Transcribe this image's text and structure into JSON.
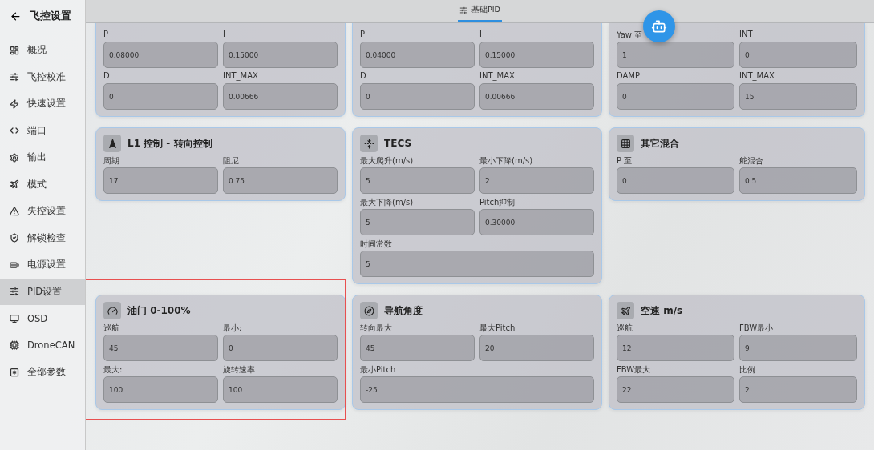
{
  "sidebar": {
    "title": "飞控设置",
    "items": [
      {
        "label": "概况",
        "selected": false
      },
      {
        "label": "飞控校准",
        "selected": false
      },
      {
        "label": "快速设置",
        "selected": false
      },
      {
        "label": "端口",
        "selected": false
      },
      {
        "label": "输出",
        "selected": false
      },
      {
        "label": "模式",
        "selected": false
      },
      {
        "label": "失控设置",
        "selected": false
      },
      {
        "label": "解锁检查",
        "selected": false
      },
      {
        "label": "电源设置",
        "selected": false
      },
      {
        "label": "PID设置",
        "selected": true
      },
      {
        "label": "OSD",
        "selected": false
      },
      {
        "label": "DroneCAN",
        "selected": false
      },
      {
        "label": "全部参数",
        "selected": false
      }
    ]
  },
  "tabs": [
    {
      "label": "基础PID",
      "selected": true
    }
  ],
  "cards": [
    {
      "fields": [
        {
          "label": "P",
          "value": "0.08000"
        },
        {
          "label": "I",
          "value": "0.15000"
        },
        {
          "label": "D",
          "value": "0"
        },
        {
          "label": "INT_MAX",
          "value": "0.00666"
        }
      ]
    },
    {
      "fields": [
        {
          "label": "P",
          "value": "0.04000"
        },
        {
          "label": "I",
          "value": "0.15000"
        },
        {
          "label": "D",
          "value": "0"
        },
        {
          "label": "INT_MAX",
          "value": "0.00666"
        }
      ]
    },
    {
      "fields": [
        {
          "label": "Yaw 至",
          "value": "1"
        },
        {
          "label": "INT",
          "value": "0"
        },
        {
          "label": "DAMP",
          "value": "0"
        },
        {
          "label": "INT_MAX",
          "value": "15"
        }
      ]
    },
    {
      "title": "L1 控制 - 转向控制",
      "fields": [
        {
          "label": "周期",
          "value": "17"
        },
        {
          "label": "阻尼",
          "value": "0.75"
        }
      ]
    },
    {
      "title": "TECS",
      "fields": [
        {
          "label": "最大爬升(m/s)",
          "value": "5"
        },
        {
          "label": "最小下降(m/s)",
          "value": "2"
        },
        {
          "label": "最大下降(m/s)",
          "value": "5"
        },
        {
          "label": "Pitch抑制",
          "value": "0.30000"
        },
        {
          "label": "时间常数",
          "value": "5",
          "wide": true
        }
      ]
    },
    {
      "title": "其它混合",
      "fields": [
        {
          "label": "P 至",
          "value": "0"
        },
        {
          "label": "舵混合",
          "value": "0.5"
        }
      ]
    },
    {
      "title": "油门 0-100%",
      "highlighted": true,
      "fields": [
        {
          "label": "巡航",
          "value": "45"
        },
        {
          "label": "最小:",
          "value": "0"
        },
        {
          "label": "最大:",
          "value": "100"
        },
        {
          "label": "旋转速率",
          "value": "100"
        }
      ]
    },
    {
      "title": "导航角度",
      "fields": [
        {
          "label": "转向最大",
          "value": "45"
        },
        {
          "label": "最大Pitch",
          "value": "20"
        },
        {
          "label": "最小Pitch",
          "value": "-25",
          "wide": true
        }
      ]
    },
    {
      "title": "空速 m/s",
      "fields": [
        {
          "label": "巡航",
          "value": "12"
        },
        {
          "label": "FBW最小",
          "value": "9"
        },
        {
          "label": "FBW最大",
          "value": "22"
        },
        {
          "label": "比例",
          "value": "2"
        }
      ]
    }
  ]
}
